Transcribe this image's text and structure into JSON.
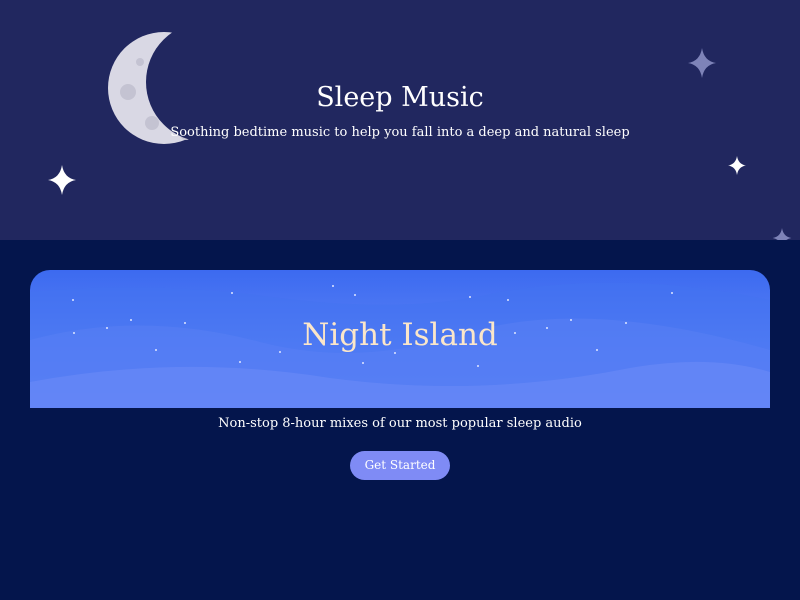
{
  "hero": {
    "title": "Sleep Music",
    "subtitle": "Soothing bedtime music to help you fall into a deep and natural sleep",
    "background": "#21275f",
    "icons": [
      "crescent-moon-icon",
      "sparkle-star-icon"
    ]
  },
  "card": {
    "title": "Night Island",
    "description": "Non-stop 8-hour mixes of our most popular sleep audio",
    "title_color": "#fbe6c9",
    "icons": [
      "crescent-moon-icon"
    ]
  },
  "cta": {
    "label": "Get Started",
    "color": "#7f8bf5"
  },
  "colors": {
    "page_background": "#04154c",
    "text": "#ffffff"
  }
}
